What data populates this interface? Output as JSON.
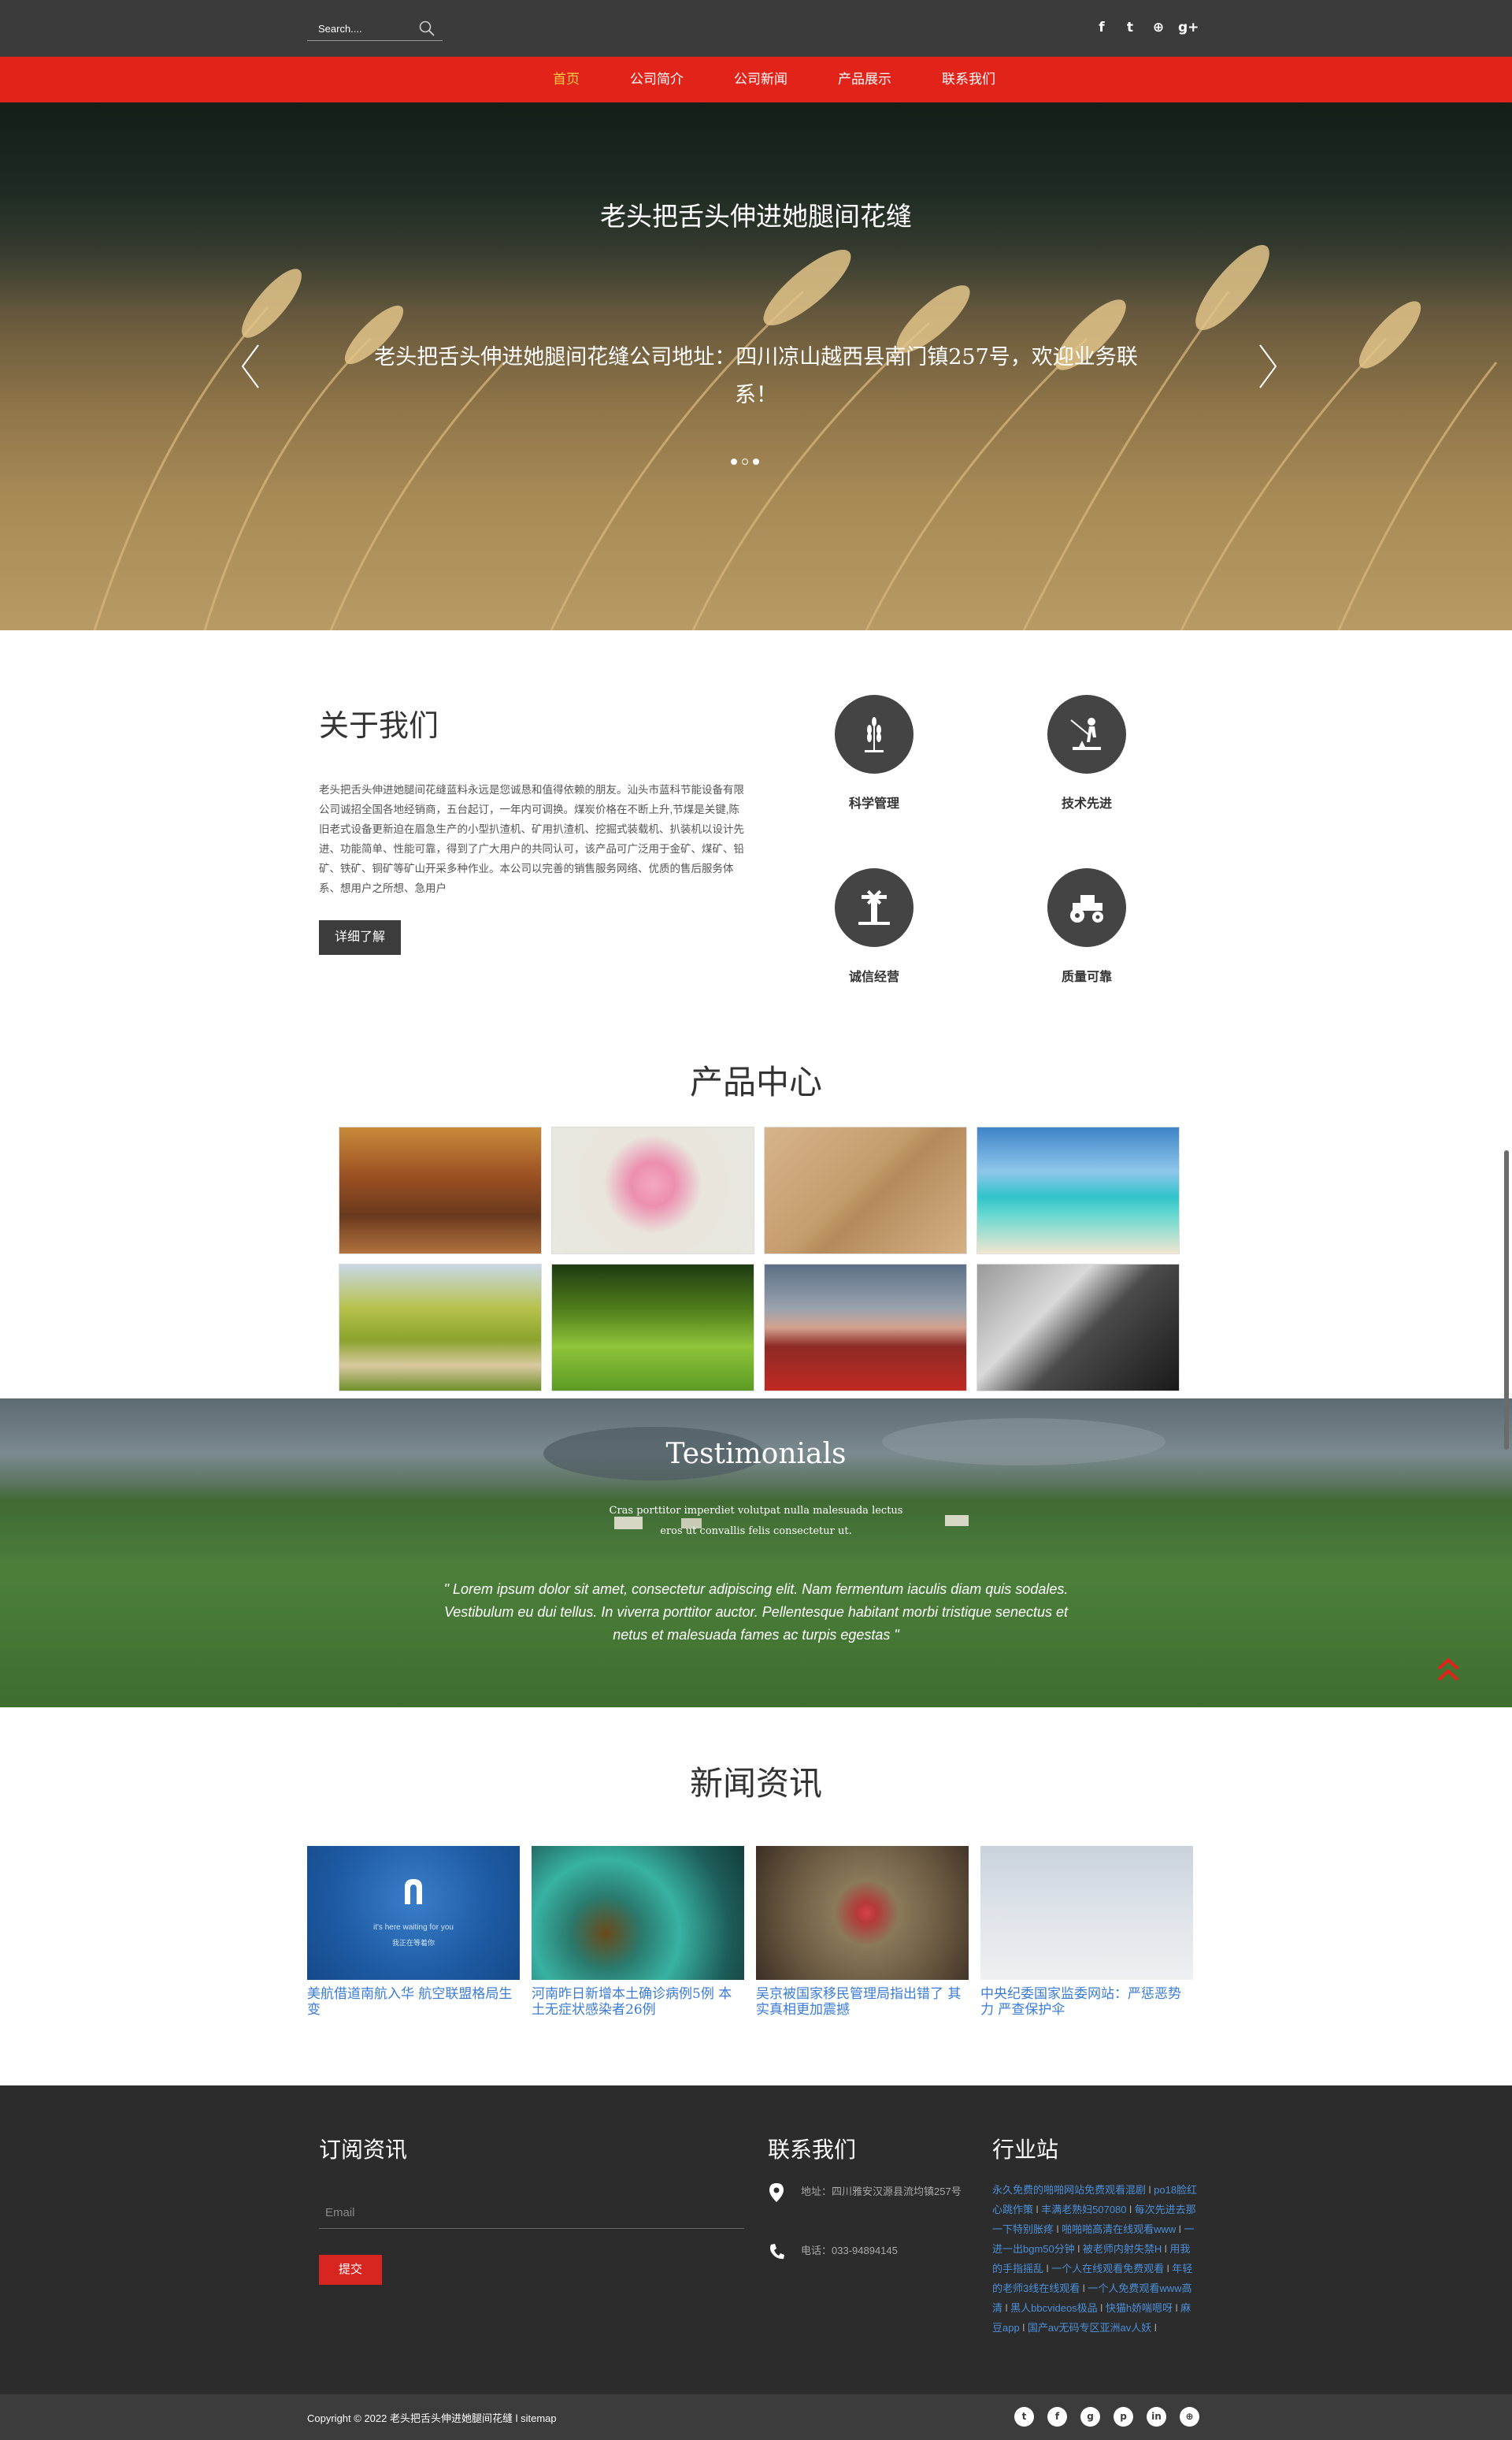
{
  "topbar": {
    "search_placeholder": "Search....",
    "socials": [
      "f",
      "t",
      "⊕",
      "g+"
    ]
  },
  "nav": {
    "items": [
      "首页",
      "公司简介",
      "公司新闻",
      "产品展示",
      "联系我们"
    ],
    "active": "首页"
  },
  "hero": {
    "title": "老头把舌头伸进她腿间花缝",
    "text": "老头把舌头伸进她腿间花缝公司地址：四川凉山越西县南门镇257号，欢迎业务联系！"
  },
  "about": {
    "title": "关于我们",
    "text": "老头把舌头伸进她腿间花缝蓝料永远是您诚恳和值得依赖的朋友。汕头市蓝科节能设备有限公司诚招全国各地经销商，五台起订，一年内可调换。煤炭价格在不断上升,节煤是关键,陈旧老式设备更新迫在眉急生产的小型扒渣机、矿用扒渣机、挖掘式装载机、扒装机以设计先进、功能简单、性能可靠，得到了广大用户的共同认可，该产品可广泛用于金矿、煤矿、铅矿、铁矿、铜矿等矿山开采多种作业。本公司以完善的销售服务网络、优质的售后服务体系、想用户之所想、急用户",
    "button": "详细了解",
    "features": [
      "科学管理",
      "技术先进",
      "诚信经营",
      "质量可靠"
    ]
  },
  "products": {
    "title": "产品中心"
  },
  "testimonials": {
    "title": "Testimonials",
    "subtitle": "Cras porttitor imperdiet volutpat nulla malesuada lectus eros ut convallis felis consectetur ut.",
    "quote": "\" Lorem ipsum dolor sit amet, consectetur adipiscing elit. Nam fermentum iaculis diam quis sodales. Vestibulum eu dui tellus. In viverra porttitor auctor. Pellentesque habitant morbi tristique senectus et netus et malesuada fames ac turpis egestas \""
  },
  "news": {
    "title": "新闻资讯",
    "items": [
      {
        "title": "美航借道南航入华 航空联盟格局生变",
        "thumb_text_1": "it's here waiting for you",
        "thumb_text_2": "我正在等着你"
      },
      {
        "title": "河南昨日新增本土确诊病例5例 本土无症状感染者26例"
      },
      {
        "title": "吴京被国家移民管理局指出错了 其实真相更加震撼"
      },
      {
        "title": "中央纪委国家监委网站：严惩恶势力 严查保护伞"
      }
    ]
  },
  "footer": {
    "subscribe_title": "订阅资讯",
    "email_placeholder": "Email",
    "submit": "提交",
    "contact_title": "联系我们",
    "address": "地址：四川雅安汉源县流均镇257号",
    "phone": "电话：033-94894145",
    "industry_title": "行业站",
    "links": [
      "永久免费的啪啪网站免费观看混剧",
      "po18脸红心跳作策",
      "丰满老熟妇507080",
      "每次先进去那一下特别胀疼",
      "啪啪啪高清在线观看www",
      "一进一出bgm50分钟",
      "被老师内射失禁H",
      "用我的手指摇乱",
      "一个人在线观看免费观看",
      "年轻的老师3线在线观看",
      "一个人免费观看www高清",
      "黑人bbcvideos极品",
      "快猫h娇喘嗯呀",
      "麻豆app",
      "国产av无码专区亚洲av人妖"
    ]
  },
  "bottom": {
    "copyright": "Copyright © 2022 老头把舌头伸进她腿间花缝 l sitemap",
    "socials": [
      "t",
      "f",
      "g",
      "p",
      "in",
      "⊕"
    ]
  },
  "colors": {
    "nav_red": "#e2231a",
    "dark_bar": "#3b3b3b",
    "footer_bg": "#2c2c2c",
    "link_blue": "#3a7bd5",
    "active_nav": "#f6d24a"
  }
}
